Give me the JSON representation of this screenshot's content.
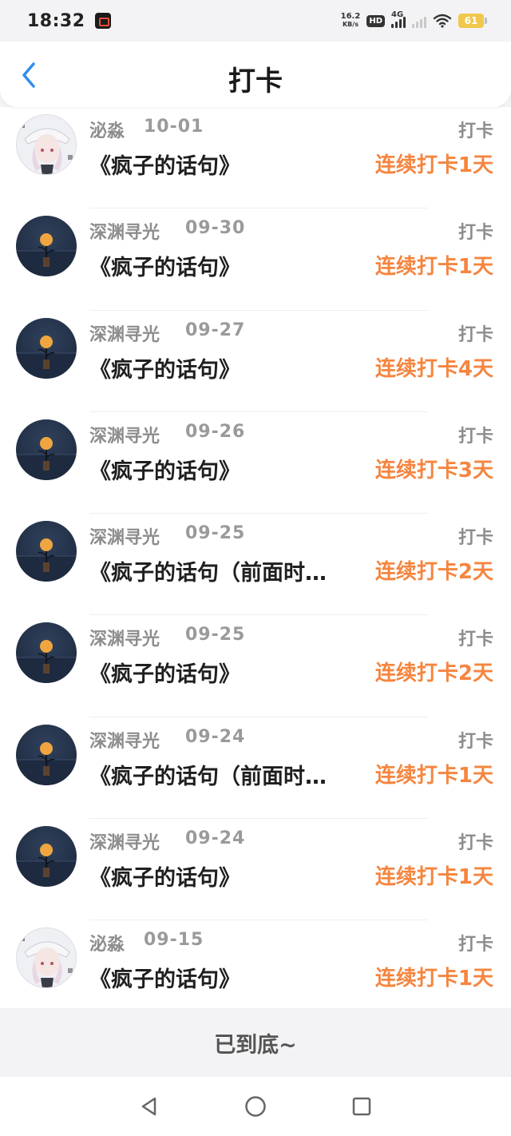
{
  "status_bar": {
    "time": "18:32",
    "net_speed_value": "16.2",
    "net_speed_unit": "KB/s",
    "hd_label": "HD",
    "network_label": "4G",
    "battery": "61"
  },
  "header": {
    "title": "打卡"
  },
  "records": [
    {
      "name": "泌淼",
      "date": "10-01",
      "type": "打卡",
      "title": "《疯子的话句》",
      "streak": "连续打卡1天",
      "avatar": "anime"
    },
    {
      "name": "深渊寻光",
      "date": "09-30",
      "type": "打卡",
      "title": "《疯子的话句》",
      "streak": "连续打卡1天",
      "avatar": "moon"
    },
    {
      "name": "深渊寻光",
      "date": "09-27",
      "type": "打卡",
      "title": "《疯子的话句》",
      "streak": "连续打卡4天",
      "avatar": "moon"
    },
    {
      "name": "深渊寻光",
      "date": "09-26",
      "type": "打卡",
      "title": "《疯子的话句》",
      "streak": "连续打卡3天",
      "avatar": "moon"
    },
    {
      "name": "深渊寻光",
      "date": "09-25",
      "type": "打卡",
      "title": "《疯子的话句（前面时…",
      "streak": "连续打卡2天",
      "avatar": "moon"
    },
    {
      "name": "深渊寻光",
      "date": "09-25",
      "type": "打卡",
      "title": "《疯子的话句》",
      "streak": "连续打卡2天",
      "avatar": "moon"
    },
    {
      "name": "深渊寻光",
      "date": "09-24",
      "type": "打卡",
      "title": "《疯子的话句（前面时…",
      "streak": "连续打卡1天",
      "avatar": "moon"
    },
    {
      "name": "深渊寻光",
      "date": "09-24",
      "type": "打卡",
      "title": "《疯子的话句》",
      "streak": "连续打卡1天",
      "avatar": "moon"
    },
    {
      "name": "泌淼",
      "date": "09-15",
      "type": "打卡",
      "title": "《疯子的话句》",
      "streak": "连续打卡1天",
      "avatar": "anime"
    }
  ],
  "footer": {
    "end_text": "已到底~"
  },
  "colors": {
    "accent_orange": "#f5853f",
    "back_blue": "#2f8ff0",
    "muted_gray": "#8d8d8d"
  }
}
